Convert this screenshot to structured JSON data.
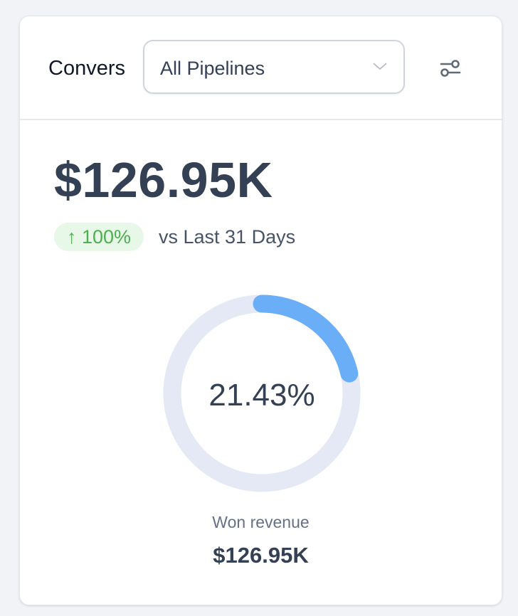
{
  "header": {
    "title": "Convers",
    "pipeline_select": "All Pipelines",
    "filter_icon": "sliders-icon"
  },
  "metric": {
    "value": "$126.95K",
    "change_badge": "↑ 100%",
    "comparison": "vs Last 31 Days"
  },
  "donut": {
    "percent_label": "21.43%",
    "percent": 21.43,
    "fill_color": "#6aaef8",
    "track_color": "#e5e9f6"
  },
  "footer": {
    "label": "Won revenue",
    "value": "$126.95K"
  }
}
